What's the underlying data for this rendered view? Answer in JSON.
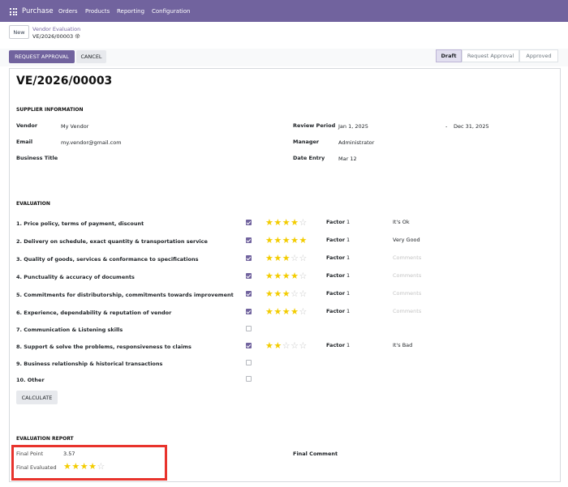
{
  "navbar": {
    "app_name": "Purchase",
    "items": [
      "Orders",
      "Products",
      "Reporting",
      "Configuration"
    ],
    "color": "#71639e"
  },
  "control": {
    "new_label": "New",
    "breadcrumb_parent": "Vendor Evaluation",
    "breadcrumb_current": "VE/2026/00003"
  },
  "actions": {
    "request_approval": "REQUEST APPROVAL",
    "cancel": "CANCEL"
  },
  "stages": [
    {
      "label": "Draft",
      "active": true
    },
    {
      "label": "Request Approval",
      "active": false
    },
    {
      "label": "Approved",
      "active": false
    }
  ],
  "record": {
    "title": "VE/2026/00003",
    "supplier_section": "SUPPLIER INFORMATION",
    "vendor_label": "Vendor",
    "vendor": "My Vendor",
    "email_label": "Email",
    "email": "my.vendor@gmail.com",
    "business_title_label": "Business Title",
    "review_period_label": "Review Period",
    "review_start": "Jan 1, 2025",
    "review_sep": "-",
    "review_end": "Dec 31, 2025",
    "manager_label": "Manager",
    "manager": "Administrator",
    "date_entry_label": "Date Entry",
    "date_entry": "Mar 12"
  },
  "evaluation": {
    "section": "EVALUATION",
    "factor_label": "Factor",
    "comment_placeholder": "Comments",
    "criteria": [
      {
        "label": "1. Price policy, terms of payment, discount",
        "checked": true,
        "rating": 4,
        "factor": "1",
        "comment": "It's Ok"
      },
      {
        "label": "2. Delivery on schedule, exact quantity & transportation service",
        "checked": true,
        "rating": 5,
        "factor": "1",
        "comment": "Very Good"
      },
      {
        "label": "3. Quality of goods, services & conformance to specifications",
        "checked": true,
        "rating": 3,
        "factor": "1",
        "comment": ""
      },
      {
        "label": "4. Punctuality & accuracy of documents",
        "checked": true,
        "rating": 4,
        "factor": "1",
        "comment": ""
      },
      {
        "label": "5. Commitments for distributorship, commitments towards improvement",
        "checked": true,
        "rating": 3,
        "factor": "1",
        "comment": ""
      },
      {
        "label": "6. Experience, dependability & reputation of vendor",
        "checked": true,
        "rating": 4,
        "factor": "1",
        "comment": ""
      },
      {
        "label": "7. Communication & Listening skills",
        "checked": false
      },
      {
        "label": "8. Support & solve the problems, responsiveness to claims",
        "checked": true,
        "rating": 2,
        "factor": "1",
        "comment": "It's Bad"
      },
      {
        "label": "9. Business relationship & historical transactions",
        "checked": false
      },
      {
        "label": "10. Other",
        "checked": false
      }
    ],
    "calculate_label": "CALCULATE"
  },
  "report": {
    "section": "EVALUATION REPORT",
    "final_point_label": "Final Point",
    "final_point": "3.57",
    "final_evaluated_label": "Final Evaluated",
    "final_evaluated_rating": 4,
    "final_comment_label": "Final Comment"
  },
  "colors": {
    "brand": "#71639e",
    "star": "#f3cc00",
    "highlight": "#e8332c"
  }
}
